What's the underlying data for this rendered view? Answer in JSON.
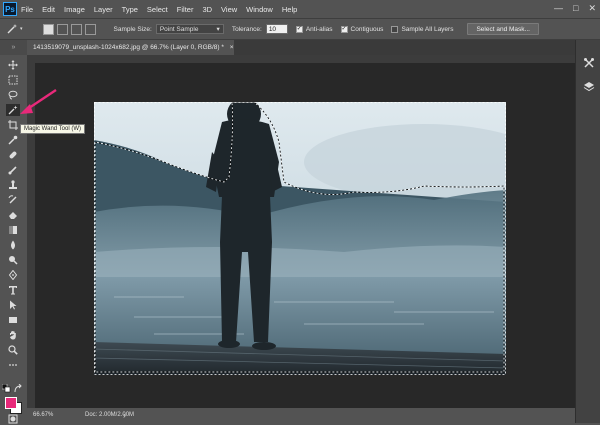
{
  "app": {
    "logo": "Ps"
  },
  "menu": [
    "File",
    "Edit",
    "Image",
    "Layer",
    "Type",
    "Select",
    "Filter",
    "3D",
    "View",
    "Window",
    "Help"
  ],
  "window_controls": {
    "minimize": "—",
    "maximize": "□",
    "close": "✕"
  },
  "options": {
    "sample_size_label": "Sample Size:",
    "sample_size_value": "Point Sample",
    "tolerance_label": "Tolerance:",
    "tolerance_value": "10",
    "anti_alias_label": "Anti-alias",
    "anti_alias_checked": true,
    "contiguous_label": "Contiguous",
    "contiguous_checked": true,
    "sample_all_layers_label": "Sample All Layers",
    "sample_all_layers_checked": false,
    "select_mask_label": "Select and Mask..."
  },
  "document": {
    "tab_title": "1413519079_unsplash-1024x682.jpg @ 66.7% (Layer 0, RGB/8) *",
    "close_glyph": "×"
  },
  "tooltip": {
    "text": "Magic Wand Tool (W)"
  },
  "status": {
    "zoom": "66.67%",
    "doc": "Doc: 2.00M/2.00M",
    "arrow": "›"
  },
  "toolbar": {
    "grip": "»"
  },
  "icons": [
    "move-icon",
    "marquee-icon",
    "lasso-icon",
    "magic-wand-icon",
    "crop-icon",
    "eyedropper-icon",
    "healing-brush-icon",
    "brush-icon",
    "clone-stamp-icon",
    "history-brush-icon",
    "eraser-icon",
    "gradient-icon",
    "blur-icon",
    "dodge-icon",
    "pen-icon",
    "type-icon",
    "path-selection-icon",
    "rectangle-icon",
    "hand-icon",
    "zoom-icon"
  ],
  "colors": {
    "foreground": "#e8297a",
    "background": "#ffffff",
    "accent": "#31a8ff",
    "arrow": "#e8297a"
  }
}
